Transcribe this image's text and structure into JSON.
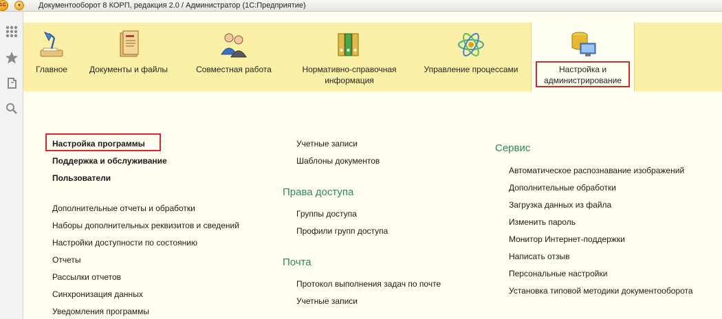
{
  "window": {
    "title": "Документооборот 8 КОРП, редакция 2.0 / Администратор  (1С:Предприятие)",
    "logo_text": "1С"
  },
  "sections": [
    {
      "label": "Главное",
      "icon": "desk-lamp-icon"
    },
    {
      "label": "Документы и файлы",
      "icon": "document-folder-icon"
    },
    {
      "label": "Совместная работа",
      "icon": "people-icon"
    },
    {
      "label": "Нормативно-справочная информация",
      "icon": "binders-icon"
    },
    {
      "label": "Управление процессами",
      "icon": "process-atom-icon"
    },
    {
      "label": "Настройка и администрирование",
      "icon": "computer-database-icon",
      "active": true
    }
  ],
  "left_column": {
    "bold_links": [
      "Настройка программы",
      "Поддержка и обслуживание",
      "Пользователи"
    ],
    "links": [
      "Дополнительные отчеты и обработки",
      "Наборы дополнительных реквизитов и сведений",
      "Настройки доступности по состоянию",
      "Отчеты",
      "Рассылки отчетов",
      "Синхронизация данных",
      "Уведомления программы"
    ]
  },
  "middle_column": {
    "top_links": [
      "Учетные записи",
      "Шаблоны документов"
    ],
    "groups": [
      {
        "title": "Права доступа",
        "links": [
          "Группы доступа",
          "Профили групп доступа"
        ]
      },
      {
        "title": "Почта",
        "links": [
          "Протокол выполнения задач по почте",
          "Учетные записи"
        ]
      }
    ]
  },
  "right_column": {
    "title": "Сервис",
    "links": [
      "Автоматическое распознавание изображений",
      "Дополнительные обработки",
      "Загрузка данных из файла",
      "Изменить пароль",
      "Монитор Интернет-поддержки",
      "Написать отзыв",
      "Персональные настройки",
      "Установка типовой методики документооборота"
    ]
  },
  "colors": {
    "sections_bg": "#fbf0a6",
    "content_bg": "#fffef0",
    "group_title": "#2e8b57",
    "highlight": "#d9262b"
  }
}
